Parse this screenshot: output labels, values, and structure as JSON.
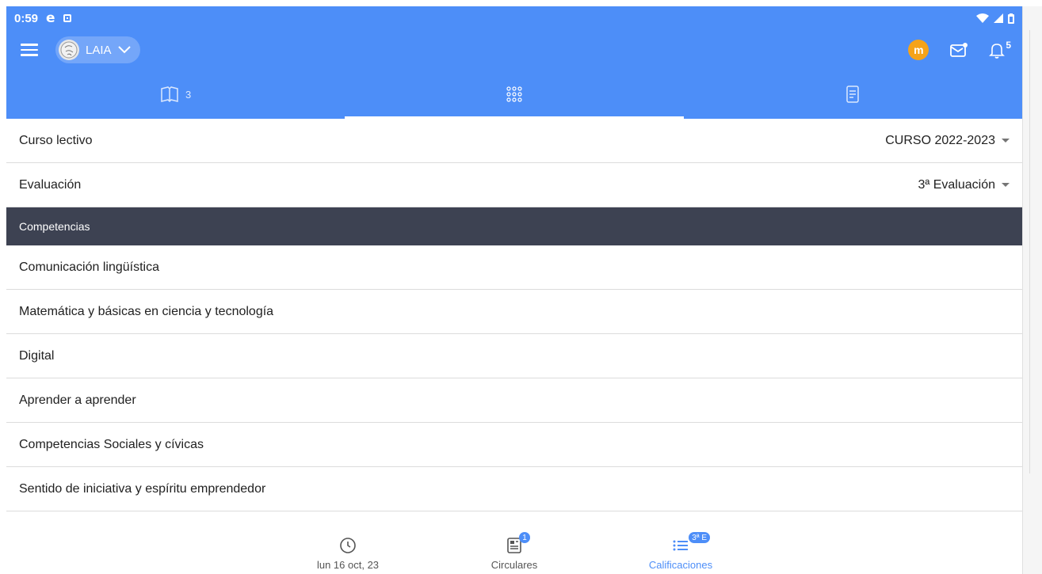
{
  "status_bar": {
    "time": "0:59"
  },
  "header": {
    "profile_name": "LAIA",
    "brand_badge": "m",
    "notifications_count": "5"
  },
  "tabs": [
    {
      "icon": "book-open-icon",
      "count": "3"
    },
    {
      "icon": "grid-dots-icon"
    },
    {
      "icon": "document-icon"
    }
  ],
  "filters": {
    "course": {
      "label": "Curso lectivo",
      "value": "CURSO 2022-2023"
    },
    "evaluation": {
      "label": "Evaluación",
      "value": "3ª Evaluación"
    }
  },
  "competencias": {
    "title": "Competencias",
    "items": [
      "Comunicación lingüística",
      "Matemática y básicas en ciencia y tecnología",
      "Digital",
      "Aprender a aprender",
      "Competencias Sociales y cívicas",
      "Sentido de iniciativa y espíritu emprendedor"
    ]
  },
  "bottom_nav": {
    "date": {
      "label": "lun 16 oct, 23"
    },
    "circulares": {
      "label": "Circulares",
      "badge": "1"
    },
    "calificaciones": {
      "label": "Calificaciones",
      "badge": "3ª E"
    }
  },
  "colors": {
    "primary": "#4d8ef8",
    "section_header": "#3d4252",
    "brand": "#f5a31a"
  }
}
